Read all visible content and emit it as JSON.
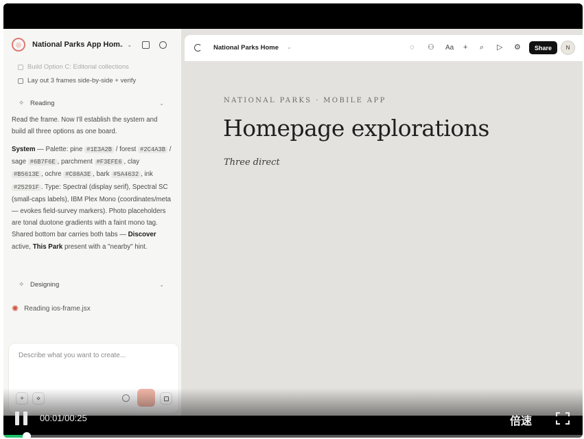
{
  "app": {
    "project_name": "National Parks App Hom...",
    "logo_glyph": "◎"
  },
  "sidebar": {
    "todos": [
      {
        "label": "Build Option C: Editorial collections",
        "faded": true
      },
      {
        "label": "Lay out 3 frames side-by-side + verify",
        "faded": false
      }
    ],
    "step_reading": "Reading",
    "step_designing": "Designing",
    "message_intro": "Read the frame. Now I'll establish the system and build all three options as one board.",
    "system_label": "System",
    "system_parts": {
      "p1": " — Palette: pine ",
      "c1": "#1E3A2B",
      "p2": " / forest ",
      "c2": "#2C4A3B",
      "p3": " / sage ",
      "c3": "#6B7F6E",
      "p4": ", parchment ",
      "c4": "#F3EFE6",
      "p5": ", clay ",
      "c5": "#B5613E",
      "p6": ", ochre ",
      "c6": "#C08A3E",
      "p7": ", bark ",
      "c7": "#5A4632",
      "p8": ", ink ",
      "c8": "#25291F",
      "p9": ". Type: Spectral (display serif), Spectral SC (small-caps labels), IBM Plex Mono (coordinates/meta — evokes field-survey markers). Photo placeholders are tonal duotone gradients with a faint mono tag. Shared bottom bar carries both tabs — ",
      "b1": "Discover",
      "p10": " active, ",
      "b2": "This Park",
      "p11": " present with a \"nearby\" hint."
    },
    "reading_file": "Reading ios-frame.jsx",
    "composer_placeholder": "Describe what you want to create..."
  },
  "toolbar": {
    "title": "National Parks Home",
    "share_label": "Share",
    "avatar_initial": "N"
  },
  "canvas": {
    "kicker": "NATIONAL PARKS · MOBILE APP",
    "heading": "Homepage explorations",
    "subheading": "Three direct"
  },
  "player": {
    "time": "00:01/00:25",
    "speed_label": "倍速",
    "progress": 0.04,
    "progress_color": "#1fc36b"
  },
  "icons": {
    "reading": "spider-icon",
    "step": "sparkle-icon"
  }
}
